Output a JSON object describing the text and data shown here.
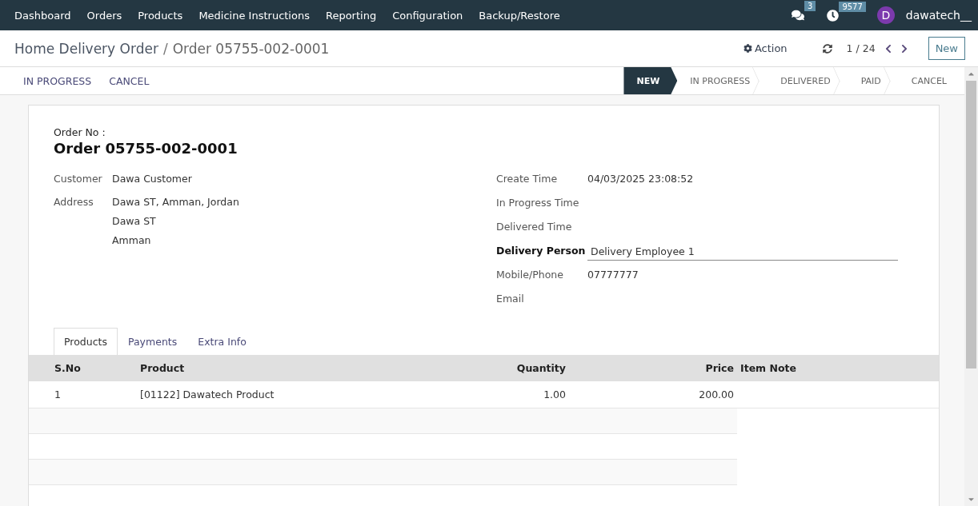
{
  "navbar": {
    "menu": [
      "Dashboard",
      "Orders",
      "Products",
      "Medicine Instructions",
      "Reporting",
      "Configuration",
      "Backup/Restore"
    ],
    "messages_count": "3",
    "activities_count": "9577",
    "avatar_letter": "D",
    "user": "dawatech__"
  },
  "breadcrumb": {
    "parent": "Home Delivery Order",
    "separator": "/",
    "current": "Order 05755-002-0001"
  },
  "control": {
    "action": "Action",
    "pager": "1 / 24",
    "new_button": "New"
  },
  "header_buttons": [
    "IN PROGRESS",
    "CANCEL"
  ],
  "stages": [
    {
      "label": "NEW",
      "selected": true
    },
    {
      "label": "IN PROGRESS",
      "selected": false
    },
    {
      "label": "DELIVERED",
      "selected": false
    },
    {
      "label": "PAID",
      "selected": false
    },
    {
      "label": "CANCEL",
      "selected": false
    }
  ],
  "form": {
    "title_label": "Order No :",
    "title": "Order 05755-002-0001",
    "left_fields": [
      {
        "label": "Customer",
        "values": [
          "Dawa Customer"
        ]
      },
      {
        "label": "Address",
        "values": [
          "Dawa ST, Amman, Jordan",
          "Dawa ST",
          "Amman"
        ]
      }
    ],
    "right_fields": [
      {
        "label": "Create Time",
        "value": "04/03/2025 23:08:52",
        "kind": "text"
      },
      {
        "label": "In Progress Time",
        "kind": "text"
      },
      {
        "label": "Delivered Time",
        "kind": "text"
      },
      {
        "label": "Delivery Person",
        "value": "Delivery Employee 1",
        "kind": "input"
      },
      {
        "label": "Mobile/Phone",
        "value": "07777777",
        "kind": "text"
      },
      {
        "label": "Email",
        "kind": "text"
      }
    ]
  },
  "tabs": [
    {
      "label": "Products",
      "selected": true
    },
    {
      "label": "Payments",
      "selected": false
    },
    {
      "label": "Extra Info",
      "selected": false
    }
  ],
  "table": {
    "columns": [
      "S.No",
      "Product",
      "Quantity",
      "Price",
      "Item Note"
    ],
    "rows": [
      [
        "1",
        "[01122] Dawatech Product",
        "1.00",
        "200.00",
        ""
      ]
    ]
  }
}
